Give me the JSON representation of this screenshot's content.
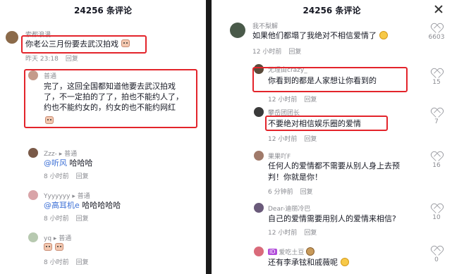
{
  "left": {
    "title": "24256 条评论",
    "comments": [
      {
        "user": "索都浪漫",
        "text": "你老公三月份要去武汉拍戏",
        "time": "昨天 23:18",
        "reply": "回复"
      },
      {
        "user": "普通",
        "text_lines": [
          "完了，这回全国都知道他要去武汉拍戏",
          "了，不一定拍的了了，拍也不能约人了，",
          "约也不能约女的，约女的也不能约网红"
        ]
      },
      {
        "user": "Zzz- ▸ 普通",
        "mention": "@听风",
        "text": " 哈哈哈",
        "time": "8 小时前",
        "reply": "回复"
      },
      {
        "user": "Yyyyyyy ▸ 普通",
        "mention": "@高耳机e",
        "text": " 哈哈哈哈哈",
        "time": "8 小时前",
        "reply": "回复"
      },
      {
        "user": "yq ▸ 普通",
        "time": "8 小时前",
        "reply": "回复"
      }
    ]
  },
  "right": {
    "title": "24256 条评论",
    "comments": [
      {
        "user": "我不梨解",
        "text": "如果他们都塌了我绝对不相信爱情了",
        "time": "12 小时前",
        "reply": "回复",
        "likes": "6603"
      },
      {
        "user": "无理由crazy_",
        "text": "你看到的都是人家想让你看到的",
        "time": "12 小时前",
        "reply": "回复",
        "likes": "15"
      },
      {
        "user": "攀岳团团长",
        "text": "不要绝对相信娱乐圈的爱情",
        "time": "12 小时前",
        "reply": "回复",
        "likes": "7"
      },
      {
        "user": "果果吖F",
        "text_lines": [
          "任何人的爱情都不需要从别人身上去预",
          "判！你就是你！"
        ],
        "time": "6 分钟前",
        "reply": "回复",
        "likes": "16"
      },
      {
        "user": "Dear-迪丽冷巴",
        "text": "自己的爱情需要用别人的爱情来相信?",
        "time": "12 小时前",
        "reply": "回复",
        "likes": "10"
      },
      {
        "user": "爱吃土豆",
        "text": "还有李承铉和戚薇呢",
        "likes": "0"
      }
    ]
  },
  "colors": {
    "highlight": "#e3242b",
    "mention": "#3b6fd6"
  }
}
